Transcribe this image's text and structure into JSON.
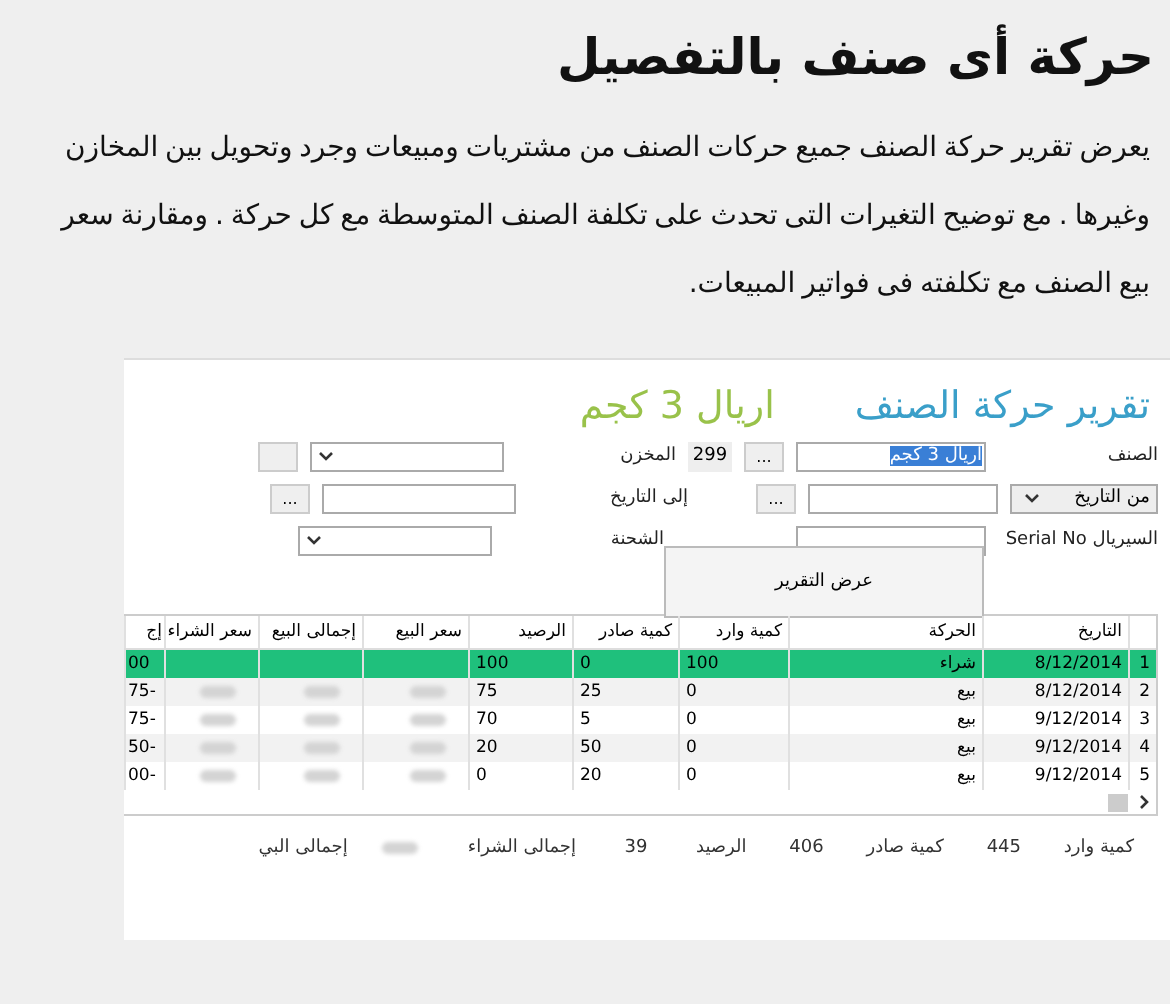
{
  "heading": "حركة أى صنف بالتفصيل",
  "paragraph": "يعرض تقرير حركة الصنف جميع حركات الصنف من مشتريات ومبيعات وجرد وتحويل بين المخازن وغيرها . مع توضيح التغيرات التى تحدث على تكلفة الصنف المتوسطة مع كل حركة . ومقارنة سعر بيع الصنف مع تكلفته فى فواتير المبيعات.",
  "app": {
    "title": "تقرير حركة الصنف",
    "item_name": "اريال 3 كجم",
    "form": {
      "item_label": "الصنف",
      "item_value": "اريال 3 كجم",
      "item_button": "...",
      "item_code": "299",
      "store_label": "المخزن",
      "from_date_dropdown": "من التاريخ",
      "from_date_button": "...",
      "to_date_label": "إلى التاريخ",
      "to_date_button": "...",
      "serial_label": "السيريال Serial No",
      "batch_label": "الشحنة",
      "show_button": "عرض التقرير"
    },
    "table": {
      "columns": [
        "التاريخ",
        "الحركة",
        "كمية وارد",
        "كمية صادر",
        "الرصيد",
        "سعر البيع",
        "إجمالى البيع",
        "سعر الشراء",
        "إج"
      ],
      "rows": [
        {
          "number": "1",
          "cells": [
            "8/12/2014",
            "شراء",
            "100",
            "0",
            "100",
            "",
            "",
            "",
            "00"
          ],
          "selected": true
        },
        {
          "number": "2",
          "cells": [
            "8/12/2014",
            "بيع",
            "0",
            "25",
            "75",
            "",
            "",
            "",
            "75-"
          ],
          "selected": false
        },
        {
          "number": "3",
          "cells": [
            "9/12/2014",
            "بيع",
            "0",
            "5",
            "70",
            "",
            "",
            "",
            "75-"
          ],
          "selected": false
        },
        {
          "number": "4",
          "cells": [
            "9/12/2014",
            "بيع",
            "0",
            "50",
            "20",
            "",
            "",
            "",
            "50-"
          ],
          "selected": false
        },
        {
          "number": "5",
          "cells": [
            "9/12/2014",
            "بيع",
            "0",
            "20",
            "0",
            "",
            "",
            "",
            "00-"
          ],
          "selected": false
        }
      ]
    },
    "totals": [
      {
        "kind": "value",
        "label": "كمية وارد",
        "value": "445"
      },
      {
        "kind": "value",
        "label": "كمية صادر",
        "value": "406"
      },
      {
        "kind": "value",
        "label": "الرصيد",
        "value": "39"
      },
      {
        "kind": "blurred",
        "label": "إجمالى الشراء"
      },
      {
        "kind": "label",
        "label": "إجمالى البي"
      }
    ]
  }
}
